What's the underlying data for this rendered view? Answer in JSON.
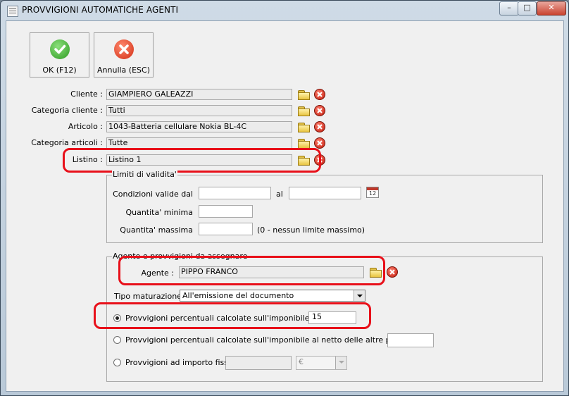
{
  "window": {
    "title": "PROVVIGIONI AUTOMATICHE AGENTI",
    "minimize_glyph": "–",
    "maximize_glyph": "□",
    "close_glyph": "✕"
  },
  "toolbar": {
    "ok_label": "OK (F12)",
    "cancel_label": "Annulla (ESC)"
  },
  "filters": {
    "cliente_label": "Cliente :",
    "cliente_value": "GIAMPIERO GALEAZZI",
    "categoria_cliente_label": "Categoria cliente :",
    "categoria_cliente_value": "Tutti",
    "articolo_label": "Articolo :",
    "articolo_value": "1043-Batteria cellulare Nokia BL-4C",
    "categoria_articoli_label": "Categoria articoli :",
    "categoria_articoli_value": "Tutte",
    "listino_label": "Listino :",
    "listino_value": "Listino 1"
  },
  "validity": {
    "group_label": "Limiti di validita'",
    "condizioni_label": "Condizioni valide dal",
    "al_label": "al",
    "from_value": "",
    "to_value": "",
    "min_qty_label": "Quantita' minima",
    "min_qty_value": "",
    "max_qty_label": "Quantita' massima",
    "max_qty_value": "",
    "max_qty_hint": "(0 - nessun limite massimo)"
  },
  "agent": {
    "group_label": "Agente e provvigioni da assegnare",
    "agente_label": "Agente :",
    "agente_value": "PIPPO FRANCO",
    "tipo_label": "Tipo maturazione :",
    "tipo_value": "All'emissione del documento",
    "options": [
      {
        "label": "Provvigioni percentuali calcolate sull'imponibile di riga",
        "value": "15",
        "selected": true
      },
      {
        "label": "Provvigioni percentuali calcolate sull'imponibile al netto delle altre provvigioni",
        "value": "",
        "selected": false
      },
      {
        "label": "Provvigioni ad importo fisso",
        "value": "",
        "selected": false
      }
    ],
    "currency_value": "€"
  },
  "colors": {
    "highlight": "#e8101a",
    "readonly_field": "#ececec",
    "dialog_bg": "#f0f0f0"
  },
  "icons": {
    "ok": "check-icon",
    "cancel": "cross-icon",
    "browse": "folder-icon",
    "clear": "clear-icon",
    "calendar": "calendar-icon"
  }
}
